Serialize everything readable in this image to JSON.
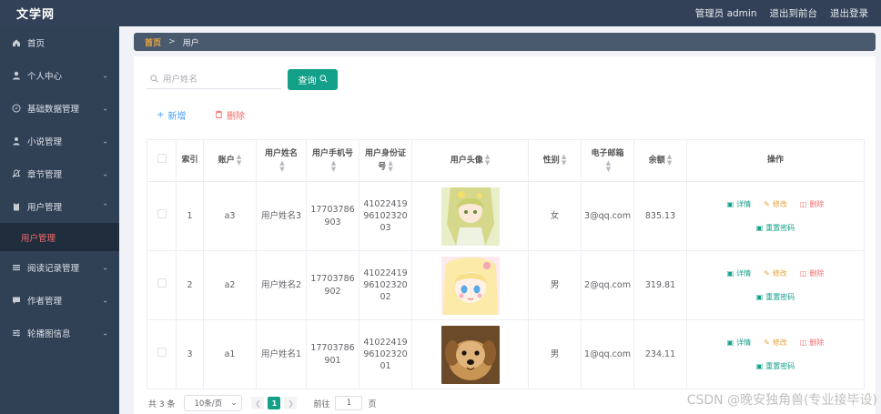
{
  "app": {
    "brand": "文学网",
    "admin_label": "管理员 admin",
    "front_link": "退出到前台",
    "logout": "退出登录"
  },
  "sidebar": {
    "items": [
      {
        "label": "首页",
        "icon": "home-icon"
      },
      {
        "label": "个人中心",
        "icon": "person-icon"
      },
      {
        "label": "基础数据管理",
        "icon": "compass-icon"
      },
      {
        "label": "小说管理",
        "icon": "user-tie-icon"
      },
      {
        "label": "章节管理",
        "icon": "bell-icon"
      },
      {
        "label": "用户管理",
        "icon": "clipboard-icon"
      },
      {
        "label": "阅读记录管理",
        "icon": "list-icon"
      },
      {
        "label": "作者管理",
        "icon": "chat-icon"
      },
      {
        "label": "轮播图信息",
        "icon": "sliders-icon"
      }
    ],
    "active_sub": "用户管理"
  },
  "breadcrumb": {
    "home": "首页",
    "sep": ">",
    "current": "用户"
  },
  "search": {
    "placeholder": "用户姓名",
    "button": "查询"
  },
  "actions": {
    "add": "新增",
    "delete": "删除"
  },
  "table": {
    "headers": {
      "index": "索引",
      "account": "账户",
      "name": "用户姓名",
      "phone": "用户手机号",
      "idcard": "用户身份证号",
      "avatar": "用户头像",
      "gender": "性别",
      "email": "电子邮箱",
      "balance": "余额",
      "ops": "操作"
    },
    "rows": [
      {
        "index": "1",
        "account": "a3",
        "name": "用户姓名3",
        "phone": "17703786903",
        "idcard": "410224199610232003",
        "avatar": "anime-girl-green",
        "gender": "女",
        "email": "3@qq.com",
        "balance": "835.13"
      },
      {
        "index": "2",
        "account": "a2",
        "name": "用户姓名2",
        "phone": "17703786902",
        "idcard": "410224199610232002",
        "avatar": "anime-girl-blonde",
        "gender": "男",
        "email": "2@qq.com",
        "balance": "319.81"
      },
      {
        "index": "3",
        "account": "a1",
        "name": "用户姓名1",
        "phone": "17703786901",
        "idcard": "410224199610232001",
        "avatar": "puppy-photo",
        "gender": "男",
        "email": "1@qq.com",
        "balance": "234.11"
      }
    ],
    "op_labels": {
      "detail": "详情",
      "edit": "修改",
      "remove": "删除",
      "reset": "重置密码"
    }
  },
  "pager": {
    "total": "共 3 条",
    "size": "10条/页",
    "current": "1",
    "goto": "前往",
    "jump_value": "1",
    "page_unit": "页"
  },
  "watermark": "CSDN @晚安独角兽(专业接毕设)",
  "colors": {
    "accent": "#13a089",
    "sidebar": "#304156",
    "topbar": "#324157",
    "danger": "#f56c6c",
    "warning": "#e6a23c",
    "primary": "#409eff"
  }
}
